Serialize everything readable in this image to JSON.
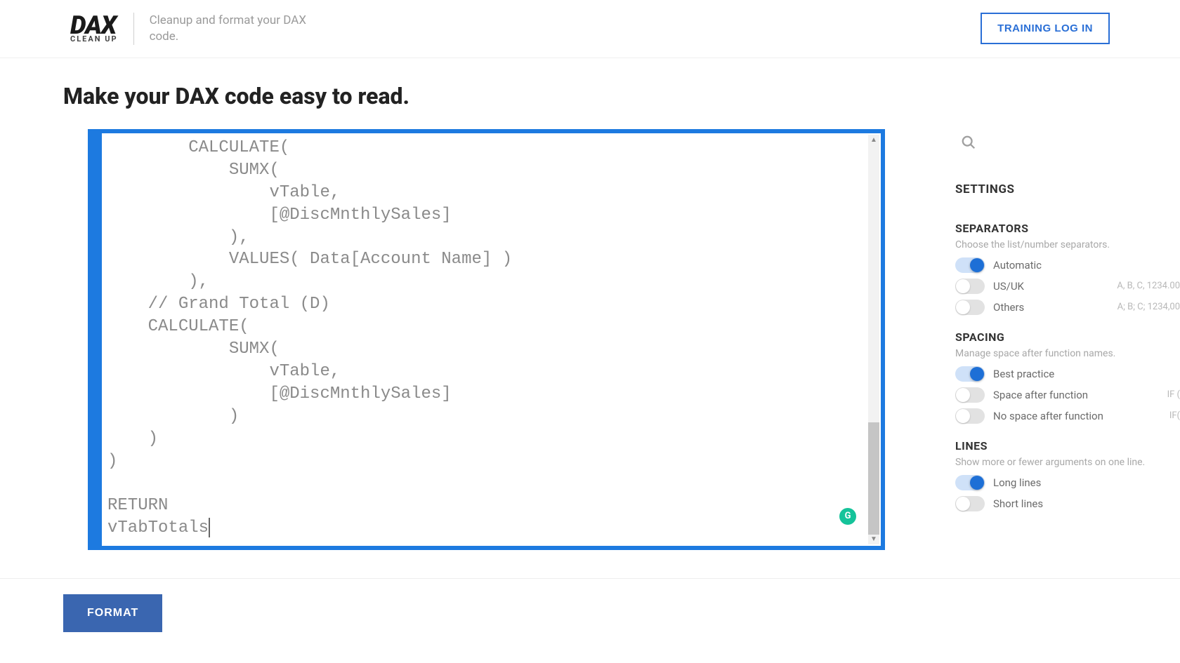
{
  "header": {
    "logo_main": "DAX",
    "logo_sub": "CLEAN UP",
    "tagline": "Cleanup and format your DAX code.",
    "training_login": "TRAINING LOG IN"
  },
  "page": {
    "title": "Make your DAX code easy to read."
  },
  "editor": {
    "code": "        CALCULATE(\n            SUMX(\n                vTable,\n                [@DiscMnthlySales]\n            ),\n            VALUES( Data[Account Name] )\n        ),\n    // Grand Total (D)\n    CALCULATE(\n            SUMX(\n                vTable,\n                [@DiscMnthlySales]\n            )\n    )\n)\n\nRETURN\nvTabTotals"
  },
  "settings": {
    "title": "SETTINGS",
    "separators": {
      "heading": "SEPARATORS",
      "sub": "Choose the list/number separators.",
      "options": [
        {
          "label": "Automatic",
          "hint": "",
          "on": true
        },
        {
          "label": "US/UK",
          "hint": "A, B, C, 1234.00",
          "on": false
        },
        {
          "label": "Others",
          "hint": "A; B; C; 1234,00",
          "on": false
        }
      ]
    },
    "spacing": {
      "heading": "SPACING",
      "sub": "Manage space after function names.",
      "options": [
        {
          "label": "Best practice",
          "hint": "",
          "on": true
        },
        {
          "label": "Space after function",
          "hint": "IF (",
          "on": false
        },
        {
          "label": "No space after function",
          "hint": "IF(",
          "on": false
        }
      ]
    },
    "lines": {
      "heading": "LINES",
      "sub": "Show more or fewer arguments on one line.",
      "options": [
        {
          "label": "Long lines",
          "hint": "",
          "on": true
        },
        {
          "label": "Short lines",
          "hint": "",
          "on": false
        }
      ]
    }
  },
  "footer": {
    "format_label": "FORMAT"
  }
}
